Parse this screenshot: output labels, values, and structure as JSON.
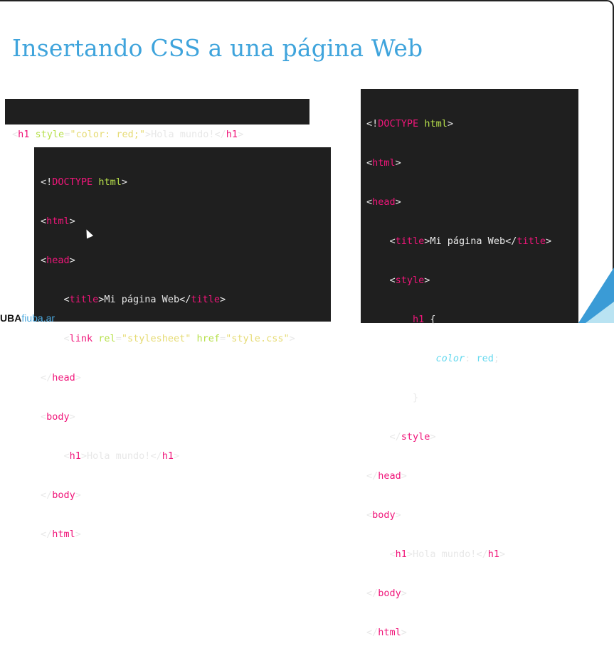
{
  "slide": {
    "title": "Insertando CSS a una página Web"
  },
  "logo": {
    "part1": "UBA",
    "part2": "fiuba.ar"
  },
  "colors": {
    "title": "#3fa4dc",
    "code_bg": "#1f1f1f",
    "tag": "#f0167a",
    "attr": "#b7e04b",
    "string": "#e6db74",
    "accent_blue": "#3a9bd6"
  },
  "inline_example": {
    "tokens": [
      "<",
      "h1",
      " ",
      "style",
      "=",
      "\"color: red;\"",
      ">Hola mundo!</",
      "h1",
      ">"
    ]
  },
  "external_example": {
    "l1": [
      "<!",
      "DOCTYPE",
      " ",
      "html",
      ">"
    ],
    "l2": [
      "<",
      "html",
      ">"
    ],
    "l3": [
      "<",
      "head",
      ">"
    ],
    "l4": [
      "    <",
      "title",
      ">Mi página Web</",
      "title",
      ">"
    ],
    "l5": [
      "    <",
      "link",
      " ",
      "rel",
      "=",
      "\"stylesheet\"",
      " ",
      "href",
      "=",
      "\"style.css\"",
      ">"
    ],
    "l6": [
      "</",
      "head",
      ">"
    ],
    "l7": [
      "<",
      "body",
      ">"
    ],
    "l8": [
      "    <",
      "h1",
      ">Hola mundo!</",
      "h1",
      ">"
    ],
    "l9": [
      "</",
      "body",
      ">"
    ],
    "l10": [
      "</",
      "html",
      ">"
    ]
  },
  "internal_example": {
    "l1": [
      "<!",
      "DOCTYPE",
      " ",
      "html",
      ">"
    ],
    "l2": [
      "<",
      "html",
      ">"
    ],
    "l3": [
      "<",
      "head",
      ">"
    ],
    "l4": [
      "    <",
      "title",
      ">Mi página Web</",
      "title",
      ">"
    ],
    "l5": [
      "    <",
      "style",
      ">"
    ],
    "l6": [
      "        ",
      "h1",
      " {"
    ],
    "l7": [
      "            ",
      "color",
      ": ",
      "red",
      ";"
    ],
    "l8": [
      "        }"
    ],
    "l9": [
      "    </",
      "style",
      ">"
    ],
    "l10": [
      "</",
      "head",
      ">"
    ],
    "l11": [
      "<",
      "body",
      ">"
    ],
    "l12": [
      "    <",
      "h1",
      ">Hola mundo!</",
      "h1",
      ">"
    ],
    "l13": [
      "</",
      "body",
      ">"
    ],
    "l14": [
      "</",
      "html",
      ">"
    ]
  }
}
